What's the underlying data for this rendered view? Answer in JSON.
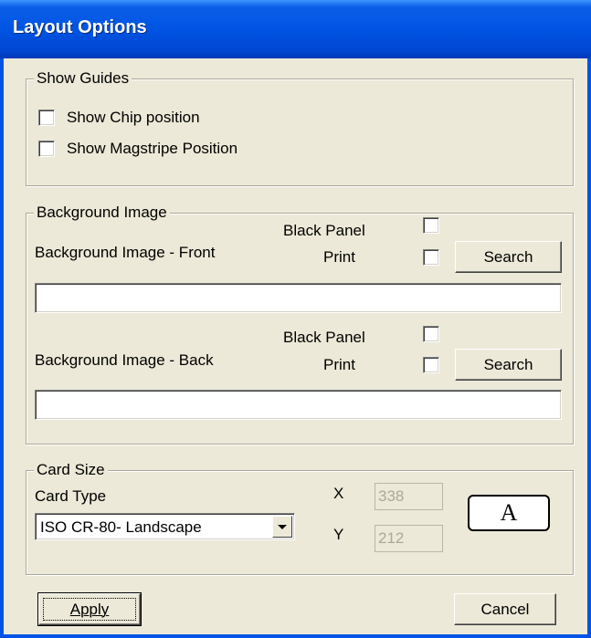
{
  "window": {
    "title": "Layout Options"
  },
  "show_guides": {
    "legend": "Show Guides",
    "chip_label": "Show Chip position",
    "chip_checked": false,
    "magstripe_label": "Show Magstripe Position",
    "magstripe_checked": false
  },
  "background_image": {
    "legend": "Background Image",
    "front": {
      "label": "Background Image - Front",
      "black_panel_label": "Black Panel",
      "black_panel_checked": false,
      "print_label": "Print",
      "print_checked": false,
      "search_label": "Search",
      "path_value": ""
    },
    "back": {
      "label": "Background Image - Back",
      "black_panel_label": "Black Panel",
      "black_panel_checked": false,
      "print_label": "Print",
      "print_checked": false,
      "search_label": "Search",
      "path_value": ""
    }
  },
  "card_size": {
    "legend": "Card Size",
    "card_type_label": "Card Type",
    "card_type_selected": "ISO CR-80- Landscape",
    "x_label": "X",
    "x_value": "338",
    "y_label": "Y",
    "y_value": "212",
    "orientation_button": "A"
  },
  "footer": {
    "apply_label": "Apply",
    "cancel_label": "Cancel"
  }
}
